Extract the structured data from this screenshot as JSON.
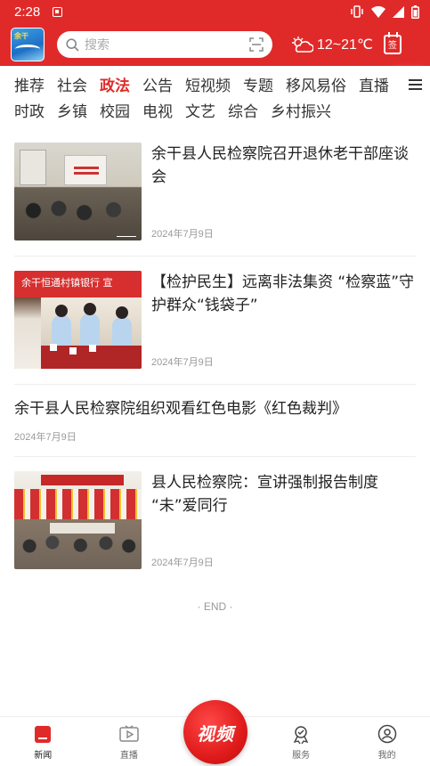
{
  "statusbar": {
    "time": "2:28"
  },
  "header": {
    "logo_text": "余干",
    "search_placeholder": "搜索",
    "weather": "12~21℃",
    "checkin_label": "签"
  },
  "channels": {
    "row1": [
      {
        "label": "推荐",
        "active": false
      },
      {
        "label": "社会",
        "active": false
      },
      {
        "label": "政法",
        "active": true
      },
      {
        "label": "公告",
        "active": false
      },
      {
        "label": "短视频",
        "active": false
      },
      {
        "label": "专题",
        "active": false
      },
      {
        "label": "移风易俗",
        "active": false
      },
      {
        "label": "直播",
        "active": false
      }
    ],
    "row2": [
      {
        "label": "时政"
      },
      {
        "label": "乡镇"
      },
      {
        "label": "校园"
      },
      {
        "label": "电视"
      },
      {
        "label": "文艺"
      },
      {
        "label": "综合"
      },
      {
        "label": "乡村振兴"
      }
    ]
  },
  "news": [
    {
      "title": "余干县人民检察院召开退休老干部座谈会",
      "date": "2024年7月9日",
      "thumb": "t1"
    },
    {
      "title": "【检护民生】远离非法集资 “检察蓝”守护群众“钱袋子”",
      "date": "2024年7月9日",
      "thumb": "t2",
      "thumb_banner": "余干恒通村镇银行 宣"
    },
    {
      "title": "余干县人民检察院组织观看红色电影《红色裁判》",
      "date": "2024年7月9日",
      "thumb": null
    },
    {
      "title": "县人民检察院：宣讲强制报告制度 “未”爱同行",
      "date": "2024年7月9日",
      "thumb": "t3"
    }
  ],
  "end_label": "· END ·",
  "bottom_nav": {
    "items": [
      {
        "label": "新闻",
        "icon": "news-icon"
      },
      {
        "label": "直播",
        "icon": "live-icon"
      },
      {
        "label": "",
        "icon": ""
      },
      {
        "label": "服务",
        "icon": "service-icon"
      },
      {
        "label": "我的",
        "icon": "profile-icon"
      }
    ],
    "center_label": "视频"
  },
  "colors": {
    "brand_red": "#e02a2a",
    "text": "#222222",
    "muted": "#999999"
  }
}
